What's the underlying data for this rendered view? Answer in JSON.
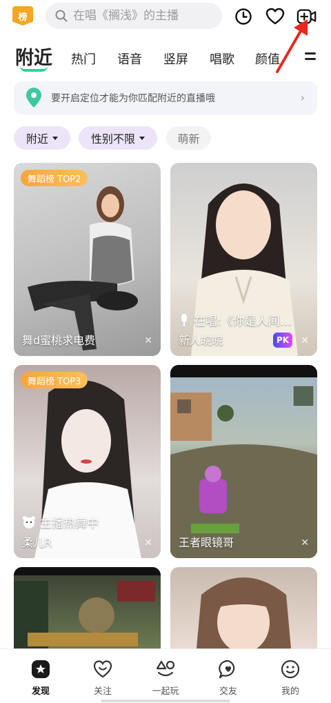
{
  "topbar": {
    "rank_label": "榜",
    "search_placeholder": "在唱《搁浅》的主播"
  },
  "tabs": [
    {
      "label": "附近"
    },
    {
      "label": "热门"
    },
    {
      "label": "语音"
    },
    {
      "label": "竖屏"
    },
    {
      "label": "唱歌"
    },
    {
      "label": "颜值"
    }
  ],
  "banner": {
    "text": "要开启定位才能为你匹配附近的直播哦"
  },
  "filters": [
    {
      "label": "附近"
    },
    {
      "label": "性别不限"
    },
    {
      "label": "萌新"
    }
  ],
  "cards": [
    {
      "badge": "舞蹈榜 TOP2",
      "name": "舞d蜜桃求电费",
      "status": ""
    },
    {
      "badge": "",
      "name": "新人皖皖",
      "status": "在唱:《你是人间…",
      "pk": "PK"
    },
    {
      "badge": "舞蹈榜 TOP3",
      "name": "柔儿R",
      "status": "主播热舞中"
    },
    {
      "badge": "",
      "name": "王者眼镜哥",
      "status": ""
    }
  ],
  "bottomnav": [
    {
      "label": "发现"
    },
    {
      "label": "关注"
    },
    {
      "label": "一起玩"
    },
    {
      "label": "交友"
    },
    {
      "label": "我的"
    }
  ],
  "colors": {
    "accent": "#2ad3a1",
    "badge": "#f5a623",
    "filter_bg": "#ece5f9",
    "annotation": "#e8281e"
  }
}
